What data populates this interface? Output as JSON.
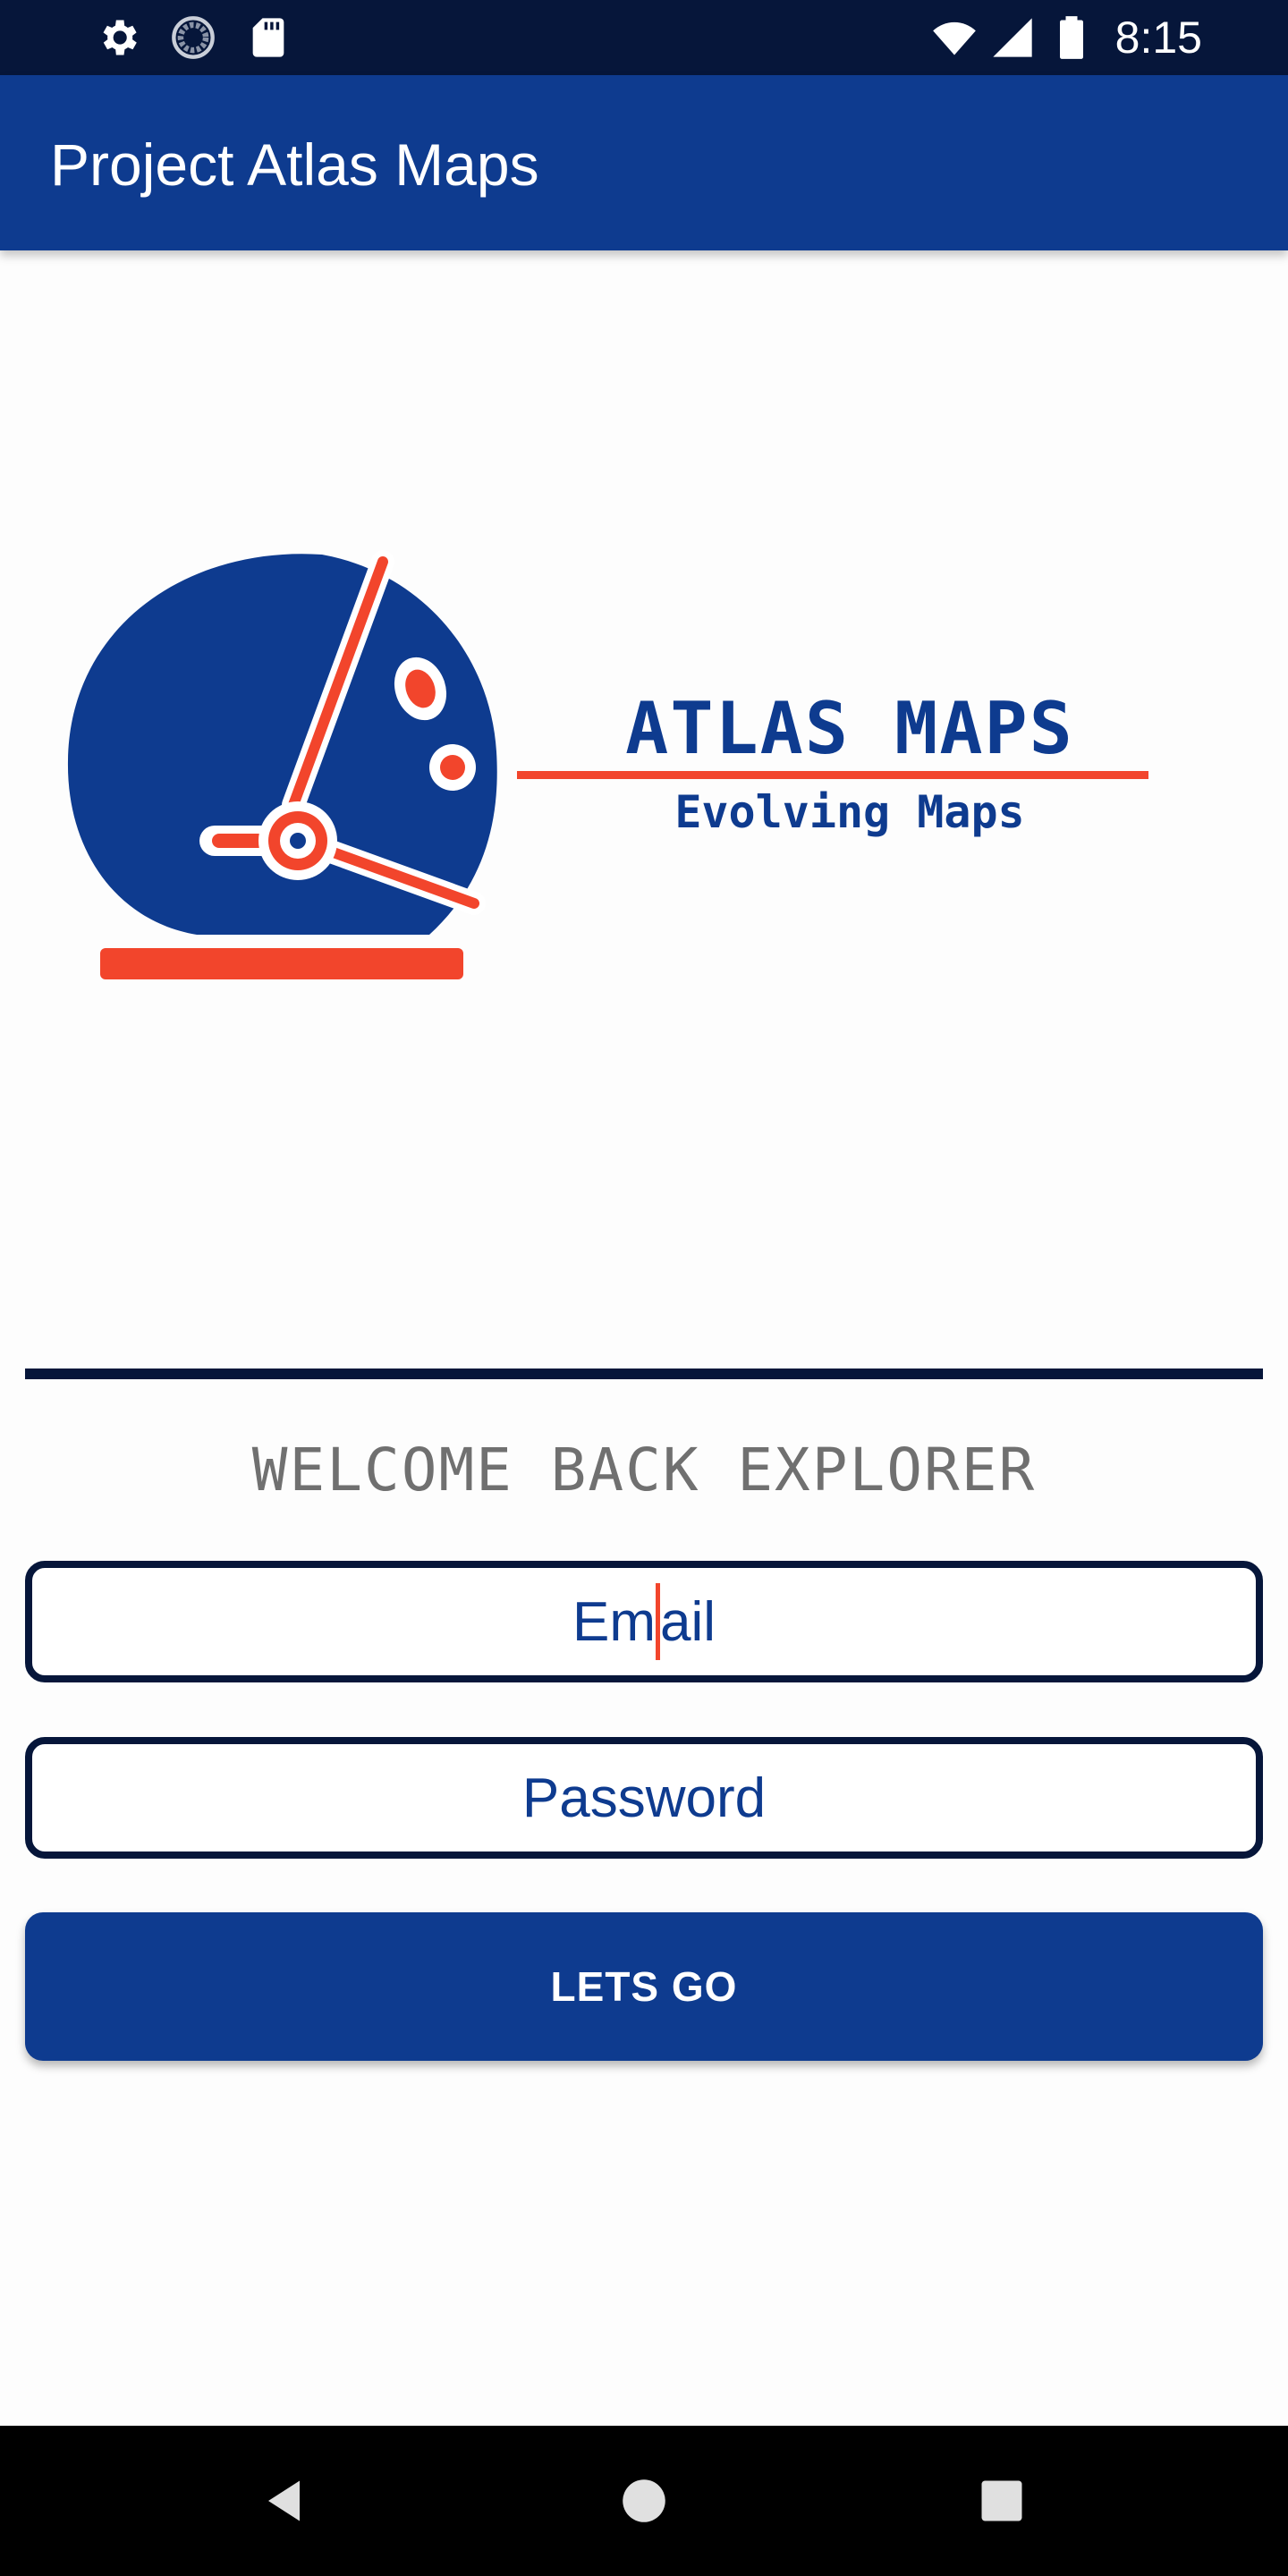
{
  "status_bar": {
    "time": "8:15",
    "left_icons": [
      "gear-icon",
      "loading-icon",
      "sd-card-icon"
    ],
    "right_icons": [
      "wifi-icon",
      "cellular-signal-icon",
      "battery-icon"
    ],
    "background_color": "#06163a"
  },
  "app_bar": {
    "title": "Project Atlas Maps",
    "background_color": "#0e3b8f"
  },
  "logo": {
    "title": "ATLAS MAPS",
    "subtitle": "Evolving Maps",
    "icon": "astronaut-helmet-icon",
    "primary_color": "#0e3b8f",
    "accent_color": "#f2452c"
  },
  "login": {
    "welcome_text": "WELCOME BACK EXPLORER",
    "email_value": "Em",
    "email_value_after_caret": "ail",
    "password_placeholder": "Password",
    "submit_label": "LETS GO"
  },
  "nav_bar": {
    "buttons": [
      "back-icon",
      "home-icon",
      "recents-icon"
    ]
  }
}
